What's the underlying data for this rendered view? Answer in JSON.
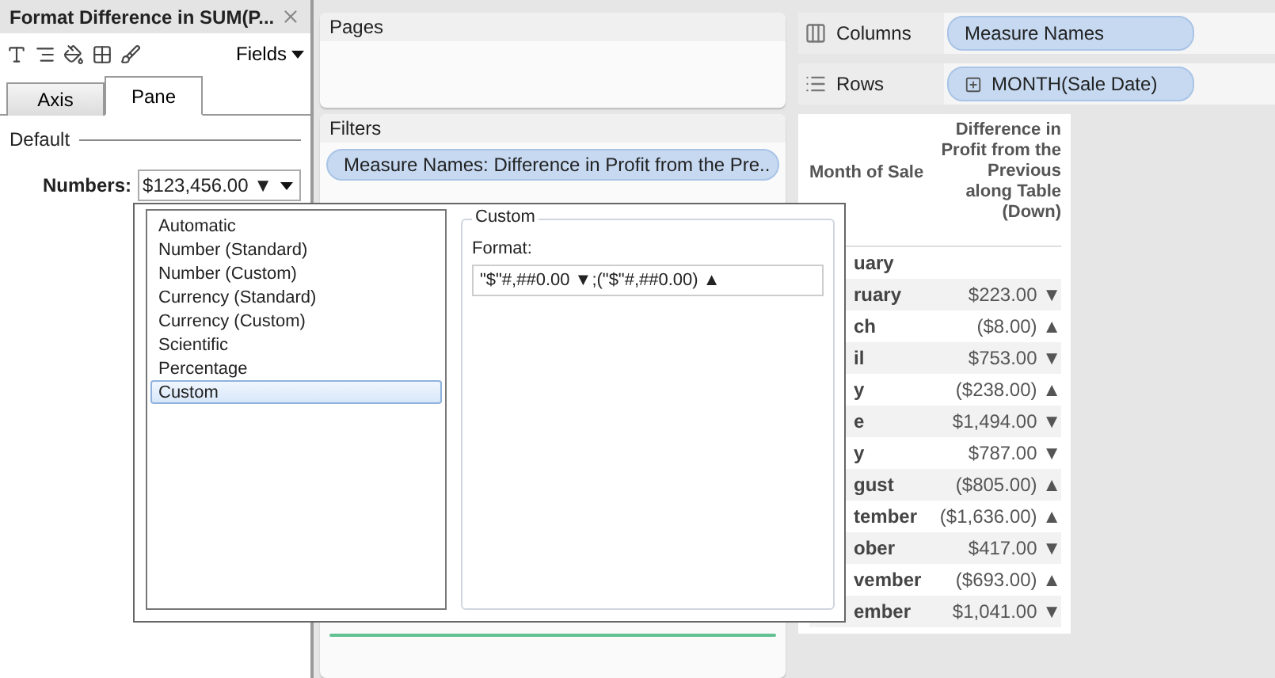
{
  "panel": {
    "title": "Format Difference in SUM(P...",
    "fields_button": "Fields",
    "tabs": [
      {
        "label": "Axis",
        "selected": false
      },
      {
        "label": "Pane",
        "selected": true
      }
    ],
    "section": "Default",
    "numbers_label": "Numbers:",
    "numbers_value": "$123,456.00 ▼"
  },
  "format_popup": {
    "types": [
      {
        "label": "Automatic",
        "selected": false
      },
      {
        "label": "Number (Standard)",
        "selected": false
      },
      {
        "label": "Number (Custom)",
        "selected": false
      },
      {
        "label": "Currency (Standard)",
        "selected": false
      },
      {
        "label": "Currency (Custom)",
        "selected": false
      },
      {
        "label": "Scientific",
        "selected": false
      },
      {
        "label": "Percentage",
        "selected": false
      },
      {
        "label": "Custom",
        "selected": true
      }
    ],
    "group_title": "Custom",
    "format_label": "Format:",
    "format_value": "\"$\"#,##0.00 ▼;(\"$\"#,##0.00) ▲"
  },
  "pages": {
    "title": "Pages"
  },
  "filters": {
    "title": "Filters",
    "pills": [
      "Measure Names: Difference in Profit from the Pre.."
    ]
  },
  "shelves": [
    {
      "label": "Columns",
      "kind": "columns",
      "pills": [
        {
          "text": "Measure Names",
          "expandable": false
        }
      ]
    },
    {
      "label": "Rows",
      "kind": "rows",
      "pills": [
        {
          "text": "MONTH(Sale Date)",
          "expandable": true
        }
      ]
    }
  ],
  "table": {
    "columns": [
      "Month of Sale",
      "Difference in Profit from the Previous along Table (Down)"
    ],
    "rows": [
      {
        "month": "uary",
        "value": ""
      },
      {
        "month": "ruary",
        "value": "$223.00 ▼"
      },
      {
        "month": "ch",
        "value": "($8.00) ▲"
      },
      {
        "month": "il",
        "value": "$753.00 ▼"
      },
      {
        "month": "y",
        "value": "($238.00) ▲"
      },
      {
        "month": "e",
        "value": "$1,494.00 ▼"
      },
      {
        "month": "y",
        "value": "$787.00 ▼"
      },
      {
        "month": "gust",
        "value": "($805.00) ▲"
      },
      {
        "month": "tember",
        "value": "($1,636.00) ▲"
      },
      {
        "month": "ober",
        "value": "$417.00 ▼"
      },
      {
        "month": "vember",
        "value": "($693.00) ▲"
      },
      {
        "month": "ember",
        "value": "$1,041.00 ▼"
      }
    ]
  }
}
